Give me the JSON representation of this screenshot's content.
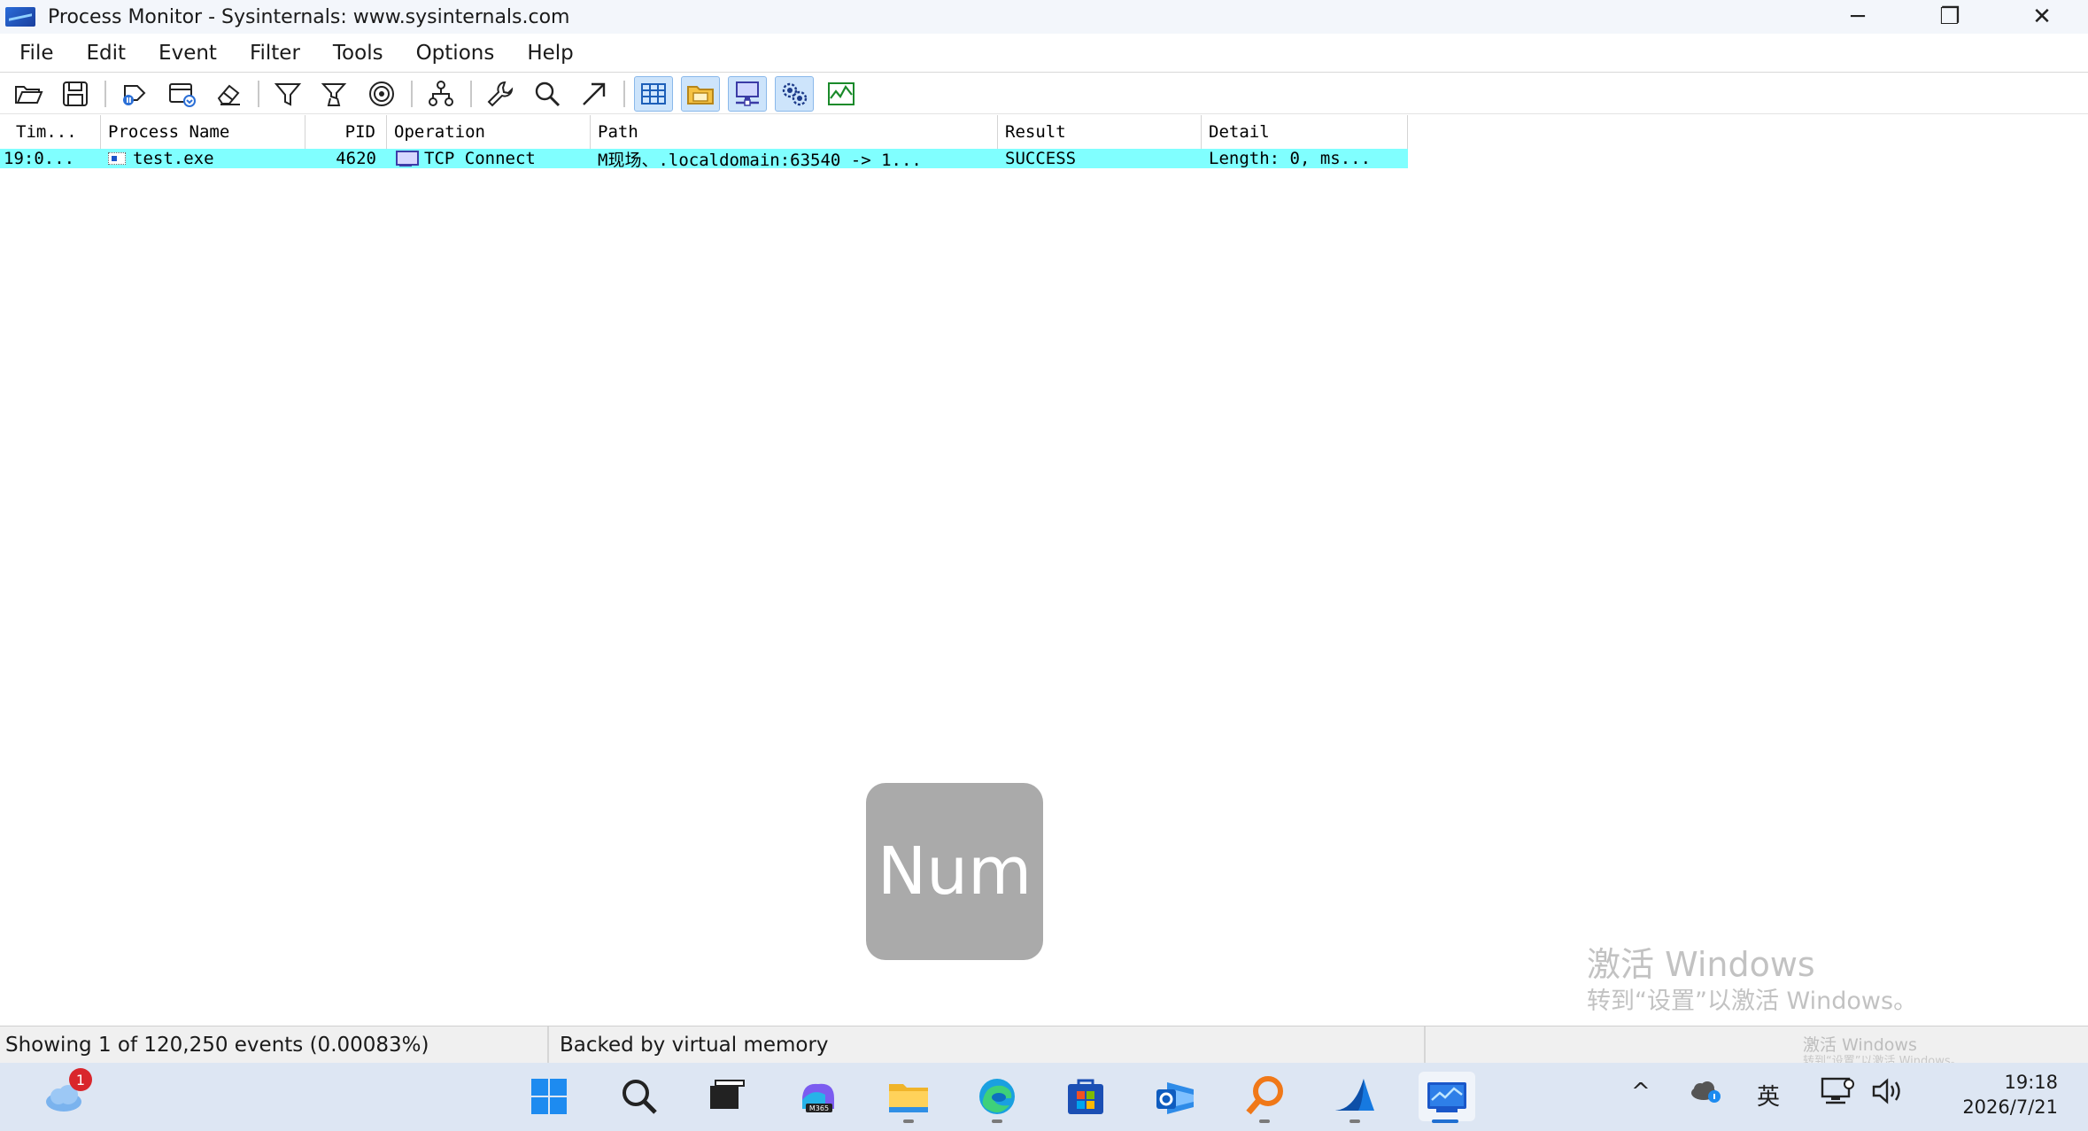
{
  "window": {
    "title": "Process Monitor - Sysinternals: www.sysinternals.com",
    "minimize_glyph": "─",
    "restore_glyph": "❐",
    "close_glyph": "✕"
  },
  "menu": [
    "File",
    "Edit",
    "Event",
    "Filter",
    "Tools",
    "Options",
    "Help"
  ],
  "toolbar": {
    "icons": [
      "open-icon",
      "save-icon",
      "capture-icon",
      "autoscroll-icon",
      "clear-icon",
      "filter-icon",
      "highlight-icon",
      "include-process-icon",
      "process-tree-icon",
      "properties-icon",
      "find-icon",
      "jump-icon",
      "registry-icon",
      "filesystem-icon",
      "network-icon",
      "process-thread-icon",
      "profiling-icon"
    ]
  },
  "grid": {
    "headers": {
      "time": "Tim...",
      "process": "Process Name",
      "pid": "PID",
      "operation": "Operation",
      "path": "Path",
      "result": "Result",
      "detail": "Detail"
    },
    "rows": [
      {
        "time": "19:0...",
        "process": "test.exe",
        "pid": "4620",
        "operation": "TCP Connect",
        "path": "M现场、.localdomain:63540 -> 1...",
        "result": "SUCCESS",
        "detail": "Length: 0, ms..."
      }
    ]
  },
  "overlay": {
    "key_label": "Num"
  },
  "watermark": {
    "title": "激活 Windows",
    "subtitle": "转到“设置”以激活 Windows。",
    "small_title": "激活 Windows",
    "small_subtitle": "转到“设置”以激活 Windows。"
  },
  "status": {
    "events": "Showing 1 of 120,250 events (0.00083%)",
    "memory": "Backed by virtual memory"
  },
  "taskbar": {
    "weather_badge": "1",
    "tray": {
      "chevron": "^",
      "ime": "英"
    },
    "time": "19:18",
    "date": "2026/7/21"
  },
  "colors": {
    "highlight_row": "#80ffff",
    "titlebar": "#f3f6fb",
    "taskbar": "#dde6f3",
    "overlay": "#aaaaaa"
  }
}
